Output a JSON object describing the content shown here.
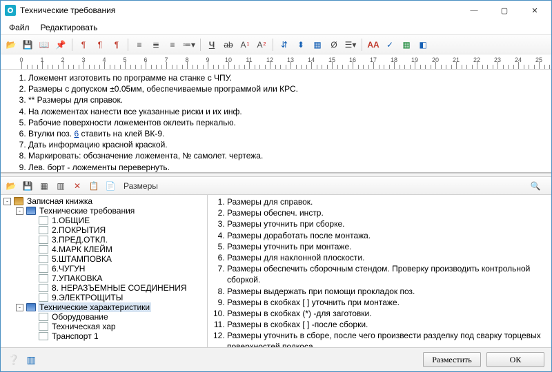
{
  "window": {
    "title": "Технические требования"
  },
  "menu": {
    "file": "Файл",
    "edit": "Редактировать"
  },
  "toolbar1": {
    "open": "open",
    "save": "save",
    "browse": "browse",
    "pin": "pin",
    "col1": "col",
    "col2": "col",
    "col3": "col",
    "align_left": "align-left",
    "center": "center",
    "justify": "justify",
    "bullets": "bullets",
    "underline": "Ч",
    "textfx": "ab",
    "super": "A",
    "sub": "A",
    "sym1": "sym",
    "sym2": "sym",
    "sym3": "sym",
    "sym4": "sym",
    "sym5": "sym",
    "font": "font",
    "ruler": "ruler",
    "table": "table",
    "view": "view"
  },
  "editor_items": [
    "Ложемент изготовить по программе на станке с ЧПУ.",
    "Размеры с допуском ±0.05мм, обеспечиваемые программой или КРС.",
    "** Размеры для справок.",
    "На ложементах нанести все указанные риски и их инф.",
    "Рабочие поверхности ложементов оклеить перкалью.",
    "Втулки поз. 6 ставить на клей ВК-9.",
    "Дать информацию красной краской.",
    "Маркировать: обозначение ложемента, № самолет. чертежа.",
    "Лев. борт - ложементы перевернуть."
  ],
  "editor_link_index": 5,
  "editor_link_char": "6",
  "lower_toolbar": {
    "label": "Размеры"
  },
  "tree": {
    "root": {
      "label": "Записная книжка"
    },
    "node1": {
      "label": "Технические требования"
    },
    "node1_children": [
      "1.ОБЩИЕ",
      "2.ПОКРЫТИЯ",
      "3.ПРЕД.ОТКЛ.",
      "4.МАРК КЛЕЙМ",
      "5.ШТАМПОВКА",
      "6.ЧУГУН",
      "7.УПАКОВКА",
      "8. НЕРАЗЪЕМНЫЕ СОЕДИНЕНИЯ",
      "9.ЭЛЕКТРОЩИТЫ"
    ],
    "node2": {
      "label": "Технические характеристики"
    },
    "node2_children": [
      "Оборудование",
      "Техническая хар",
      "Транспорт 1"
    ]
  },
  "list_items": [
    "Размеры для справок.",
    "Размеры обеспеч. инстр.",
    "Размеры уточнить при сборке.",
    "Размеры доработать после монтажа.",
    "Размеры уточнить при монтаже.",
    "Размеры  для наклонной плоскости.",
    "Размеры обеспечить сборочным стендом. Проверку производить контрольной сборкой.",
    "Размеры выдержать при помощи прокладок поз.",
    "Размеры в скобках [ ] уточнить при монтаже.",
    "Размеры в скобках (*) -для заготовки.",
    "Размеры в скобках [ ] -после сборки.",
    "Размеры уточнить в сборе, после чего произвести разделку под сварку торцевых поверхностей подкоса."
  ],
  "footer": {
    "place": "Разместить",
    "ok": "ОК"
  }
}
